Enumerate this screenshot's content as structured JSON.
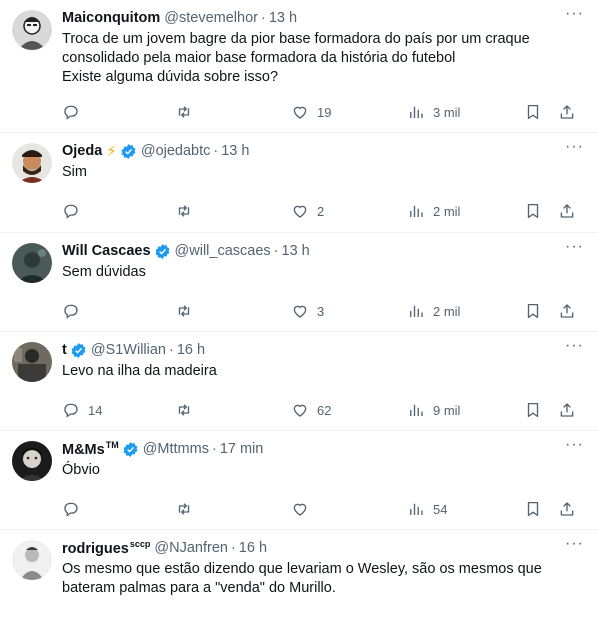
{
  "tweets": [
    {
      "name": "Maiconquitom",
      "handle": "@stevemelhor",
      "dot": "·",
      "time": "13 h",
      "text": [
        "Troca de um jovem bagre da pior base formadora do país por um craque",
        "consolidado pela maior base formadora da história do futebol",
        "Existe alguma dúvida sobre isso?"
      ],
      "replies": "",
      "retweets": "",
      "likes": "19",
      "views": "3 mil"
    },
    {
      "name": "Ojeda",
      "emoji": "⚡",
      "handle": "@ojedabtc",
      "dot": "·",
      "time": "13 h",
      "text": [
        "Sim"
      ],
      "replies": "",
      "retweets": "",
      "likes": "2",
      "views": "2 mil"
    },
    {
      "name": "Will Cascaes",
      "handle": "@will_cascaes",
      "dot": "·",
      "time": "13 h",
      "text": [
        "Sem dúvidas"
      ],
      "replies": "",
      "retweets": "",
      "likes": "3",
      "views": "2 mil"
    },
    {
      "name": "t",
      "handle": "@S1Willian",
      "dot": "·",
      "time": "16 h",
      "text": [
        "Levo na ilha da madeira"
      ],
      "replies": "14",
      "retweets": "",
      "likes": "62",
      "views": "9 mil"
    },
    {
      "name": "M&Ms",
      "name_sup": "TM",
      "handle": "@Mttmms",
      "dot": "·",
      "time": "17 min",
      "text": [
        "Óbvio"
      ],
      "replies": "",
      "retweets": "",
      "likes": "",
      "views": "54"
    },
    {
      "name": "rodrigues",
      "name_sup": "sccp",
      "handle": "@NJanfren",
      "dot": "·",
      "time": "16 h",
      "text": [
        "Os mesmo que estão dizendo que levariam o Wesley, são os mesmos que",
        "bateram palmas para a \"venda\" do Murillo."
      ]
    }
  ],
  "more_icon": "···",
  "colors": {
    "verified": "#1d9bf0",
    "muted": "#536471",
    "text": "#0f1419",
    "bolt": "#f5b40a"
  }
}
